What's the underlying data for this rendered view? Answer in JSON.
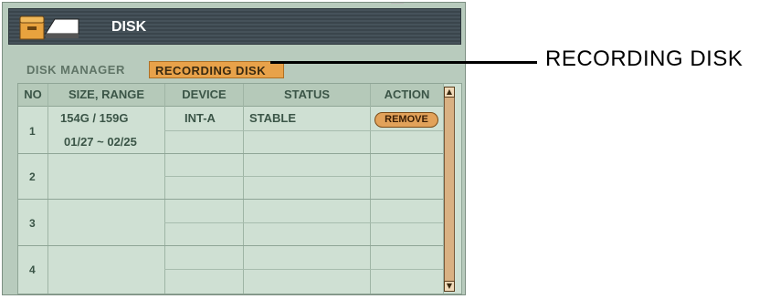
{
  "window": {
    "title": "DISK"
  },
  "tabs": [
    {
      "label": "DISK MANAGER",
      "active": false
    },
    {
      "label": "RECORDING DISK",
      "active": true
    }
  ],
  "table": {
    "columns": [
      "NO",
      "SIZE, RANGE",
      "DEVICE",
      "STATUS",
      "ACTION"
    ],
    "rows": [
      {
        "no": "1",
        "size": "154G / 159G",
        "range": "01/27 ~ 02/25",
        "device": "INT-A",
        "status": "STABLE",
        "action": "REMOVE"
      },
      {
        "no": "2",
        "size": "",
        "range": "",
        "device": "",
        "status": "",
        "action": ""
      },
      {
        "no": "3",
        "size": "",
        "range": "",
        "device": "",
        "status": "",
        "action": ""
      },
      {
        "no": "4",
        "size": "",
        "range": "",
        "device": "",
        "status": "",
        "action": ""
      }
    ]
  },
  "callout": {
    "label": "RECORDING DISK"
  },
  "colors": {
    "tab_active": "#e8a24a",
    "panel_bg": "#b8cbbd",
    "titlebar": "#46525a",
    "button": "#e2a25a"
  },
  "icons": {
    "window_icon": "hdd-icon",
    "scroll_up": "scroll-up-icon",
    "scroll_down": "scroll-down-icon"
  }
}
